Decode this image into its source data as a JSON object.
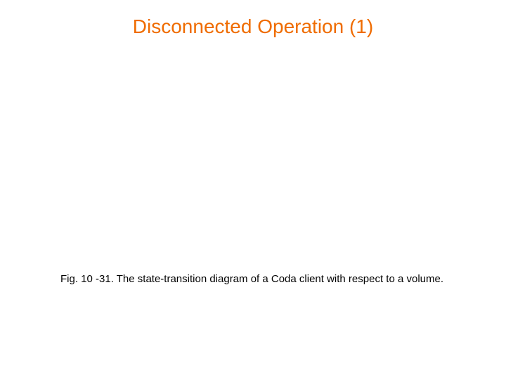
{
  "slide": {
    "title": "Disconnected Operation (1)",
    "caption": "Fig. 10 -31.  The state-transition diagram of a Coda client with respect to a volume."
  }
}
